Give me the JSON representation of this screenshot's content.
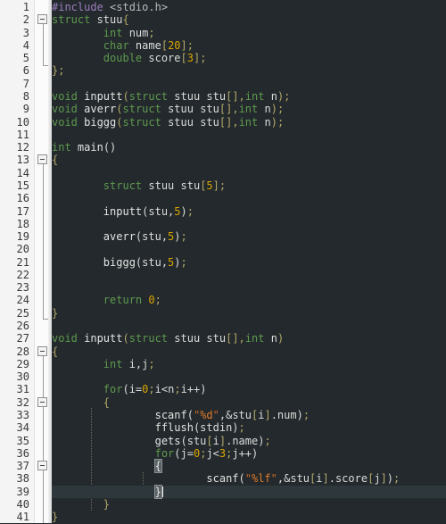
{
  "editor": {
    "language": "C",
    "total_lines": 41,
    "current_line": 39,
    "theme": {
      "background": "#23292c",
      "gutter_background": "#f4f4f4",
      "gutter_text": "#3a3a3a",
      "current_line": "#2e383c",
      "keyword": "#5f9a4f",
      "preprocessor": "#9d7fbf",
      "identifier": "#dcdcdc",
      "number": "#d8a400",
      "string": "#c8692a",
      "format_specifier": "#e07c2a",
      "punctuation": "#b3a86a",
      "caret": "#f0f0f0"
    }
  },
  "line_numbers": [
    1,
    2,
    3,
    4,
    5,
    6,
    7,
    8,
    9,
    10,
    11,
    12,
    13,
    14,
    15,
    16,
    17,
    18,
    19,
    20,
    21,
    22,
    23,
    24,
    25,
    26,
    27,
    28,
    29,
    30,
    31,
    32,
    33,
    34,
    35,
    36,
    37,
    38,
    39,
    40,
    41
  ],
  "code_lines": [
    {
      "n": 1,
      "text": "#include <stdio.h>"
    },
    {
      "n": 2,
      "text": "struct stuu{"
    },
    {
      "n": 3,
      "text": "        int num;"
    },
    {
      "n": 4,
      "text": "        char name[20];"
    },
    {
      "n": 5,
      "text": "        double score[3];"
    },
    {
      "n": 6,
      "text": "};"
    },
    {
      "n": 7,
      "text": ""
    },
    {
      "n": 8,
      "text": "void inputt(struct stuu stu[],int n);"
    },
    {
      "n": 9,
      "text": "void averr(struct stuu stu[],int n);"
    },
    {
      "n": 10,
      "text": "void biggg(struct stuu stu[],int n);"
    },
    {
      "n": 11,
      "text": ""
    },
    {
      "n": 12,
      "text": "int main()"
    },
    {
      "n": 13,
      "text": "{"
    },
    {
      "n": 14,
      "text": ""
    },
    {
      "n": 15,
      "text": "        struct stuu stu[5];"
    },
    {
      "n": 16,
      "text": ""
    },
    {
      "n": 17,
      "text": "        inputt(stu,5);"
    },
    {
      "n": 18,
      "text": ""
    },
    {
      "n": 19,
      "text": "        averr(stu,5);"
    },
    {
      "n": 20,
      "text": ""
    },
    {
      "n": 21,
      "text": "        biggg(stu,5);"
    },
    {
      "n": 22,
      "text": ""
    },
    {
      "n": 23,
      "text": ""
    },
    {
      "n": 24,
      "text": "        return 0;"
    },
    {
      "n": 25,
      "text": "}"
    },
    {
      "n": 26,
      "text": ""
    },
    {
      "n": 27,
      "text": "void inputt(struct stuu stu[],int n)"
    },
    {
      "n": 28,
      "text": "{"
    },
    {
      "n": 29,
      "text": "        int i,j;"
    },
    {
      "n": 30,
      "text": ""
    },
    {
      "n": 31,
      "text": "        for(i=0;i<n;i++)"
    },
    {
      "n": 32,
      "text": "        {"
    },
    {
      "n": 33,
      "text": "                scanf(\"%d\",&stu[i].num);"
    },
    {
      "n": 34,
      "text": "                fflush(stdin);"
    },
    {
      "n": 35,
      "text": "                gets(stu[i].name);"
    },
    {
      "n": 36,
      "text": "                for(j=0;j<3;j++)"
    },
    {
      "n": 37,
      "text": "                {"
    },
    {
      "n": 38,
      "text": "                        scanf(\"%lf\",&stu[i].score[j]);"
    },
    {
      "n": 39,
      "text": "                }"
    },
    {
      "n": 40,
      "text": "        }"
    },
    {
      "n": 41,
      "text": "}"
    }
  ],
  "tokens": {
    "include_directive": "#include",
    "include_header": "<stdio.h>",
    "keywords": [
      "struct",
      "int",
      "char",
      "double",
      "void",
      "return",
      "for"
    ],
    "struct_name": "stuu",
    "members": [
      {
        "type": "int",
        "name": "num"
      },
      {
        "type": "char",
        "name": "name",
        "size": "20"
      },
      {
        "type": "double",
        "name": "score",
        "size": "3"
      }
    ],
    "prototypes": [
      "inputt",
      "averr",
      "biggg"
    ],
    "main_fn": "main",
    "array_size": "5",
    "calls": [
      "inputt(stu,5);",
      "averr(stu,5);",
      "biggg(stu,5);"
    ],
    "return_value": "0",
    "loop_vars": [
      "i",
      "j"
    ],
    "strings": [
      "\"%d\"",
      "\"%lf\""
    ],
    "format_specifiers": [
      "%d",
      "%lf"
    ],
    "io_calls": [
      "scanf",
      "fflush",
      "gets"
    ],
    "stdin_arg": "stdin"
  },
  "fold_markers": [
    {
      "line": 2,
      "state": "expanded",
      "icon": "minus-box-icon"
    },
    {
      "line": 13,
      "state": "expanded",
      "icon": "minus-box-icon"
    },
    {
      "line": 28,
      "state": "expanded",
      "icon": "minus-box-icon"
    },
    {
      "line": 32,
      "state": "expanded",
      "icon": "minus-box-icon"
    },
    {
      "line": 37,
      "state": "expanded",
      "icon": "minus-box-icon"
    }
  ],
  "caret": {
    "line": 39,
    "after": "}"
  }
}
